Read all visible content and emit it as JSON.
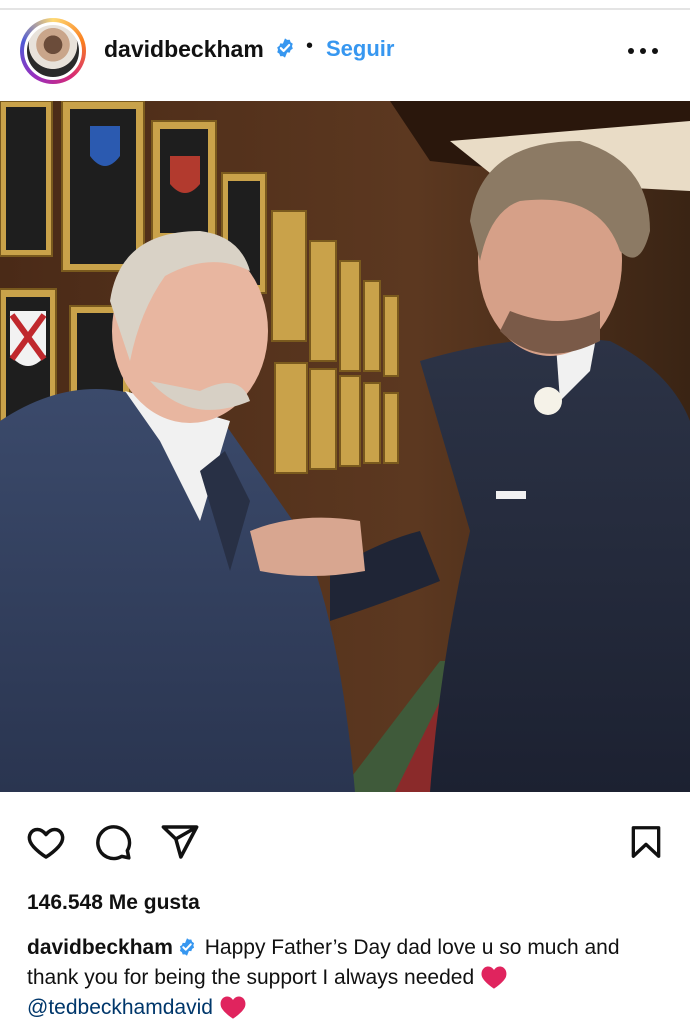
{
  "header": {
    "username": "davidbeckham",
    "separator": "•",
    "follow_label": "Seguir",
    "avatar_icon": "profile-photo",
    "verified_icon": "verified-badge-icon",
    "more_icon": "more-options-icon"
  },
  "post": {
    "image_icon": "post-photo"
  },
  "actions": {
    "like_icon": "heart-icon",
    "comment_icon": "comment-icon",
    "share_icon": "send-icon",
    "save_icon": "bookmark-icon"
  },
  "likes": {
    "text": "146.548 Me gusta"
  },
  "caption": {
    "username": "davidbeckham",
    "text": "Happy Father’s Day dad love u so much and thank you for being the support I always needed",
    "mention": "@tedbeckhamdavid",
    "emoji_icon": "red-heart-emoji"
  },
  "colors": {
    "accent": "#3797f0",
    "verified": "#3797f0",
    "mention": "#00376b",
    "heart": "#e0245e"
  }
}
